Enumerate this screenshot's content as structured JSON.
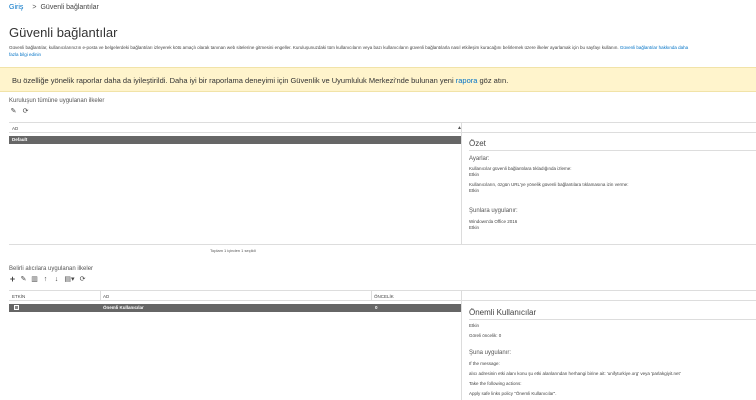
{
  "breadcrumb": {
    "home": "Giriş",
    "separator": ">",
    "current": "Güvenli bağlantılar"
  },
  "page": {
    "title": "Güvenli bağlantılar",
    "description": "Güvenli bağlantılar, kullanıcılarınızın e-posta ve belgelerdeki bağlantıları izleyerek kötü amaçlı olarak tanınan web sitelerine gitmesini engeller. Kuruluşunuzdaki tüm kullanıcıların veya bazı kullanıcıların güvenli bağlantılarla nasıl etkileşim kuracağını belirlemek üzere ilkeler ayarlamak için bu sayfayı kullanın.",
    "learn_more_1": "Güvenli bağlantılar hakkında daha",
    "learn_more_2": "fazla bilgi edinin"
  },
  "banner": {
    "text_before": "Bu özelliğe yönelik raporlar daha da iyileştirildi. Daha iyi bir raporlama deneyimi için Güvenlik ve Uyumluluk Merkezi'nde bulunan yeni ",
    "link": "rapora",
    "text_after": " göz atın."
  },
  "org_policies": {
    "label": "Kuruluşun tümüne uygulanan ilkeler",
    "toolbar_icons": [
      "edit-icon",
      "refresh-icon"
    ],
    "column_name": "AD",
    "rows": [
      {
        "name": "Default",
        "selected": true
      }
    ],
    "footer": "Toplam 1 içinden 1 seçildi"
  },
  "org_detail": {
    "title": "Özet",
    "settings_label": "Ayarlar:",
    "setting1_label": "Kullanıcılar güvenli bağlantılara tıkladığında izleme:",
    "setting1_value": "Etkin",
    "setting2_label": "Kullanıcıların, özgün URL'ye yönelik güvenli bağlantılara tıklamasına izin verme:",
    "setting2_value": "Etkin",
    "applies_label": "Şunlara uygulanır:",
    "applies1": "Windows'da Office 2016",
    "applies2": "Etkin"
  },
  "recipient_policies": {
    "label": "Belirli alıcılara uygulanan ilkeler",
    "toolbar_icons": [
      "add-icon",
      "edit-icon",
      "delete-icon",
      "move-up-icon",
      "move-down-icon",
      "export-icon",
      "refresh-icon"
    ],
    "columns": {
      "on": "ETKİN",
      "name": "AD",
      "priority": "ÖNCELİK"
    },
    "rows": [
      {
        "name": "Önemli Kullanıcılar",
        "priority": "0",
        "enabled": true
      }
    ]
  },
  "recipient_detail": {
    "title": "Önemli Kullanıcılar",
    "status": "Etkin",
    "priority": "Göreli öncelik: 0",
    "applies_label": "Şuna uygulanır:",
    "line1": "If the message:",
    "line2": "alıcı adresinin etki alanı konu şu etki alanlarından herhangi birine ait: 'unifyturkiye.org' veya 'parlakgiyit.net'",
    "line3": "Take the following actions:",
    "line4": "Apply safe links policy \"Önemli Kullanıcılar\"."
  }
}
